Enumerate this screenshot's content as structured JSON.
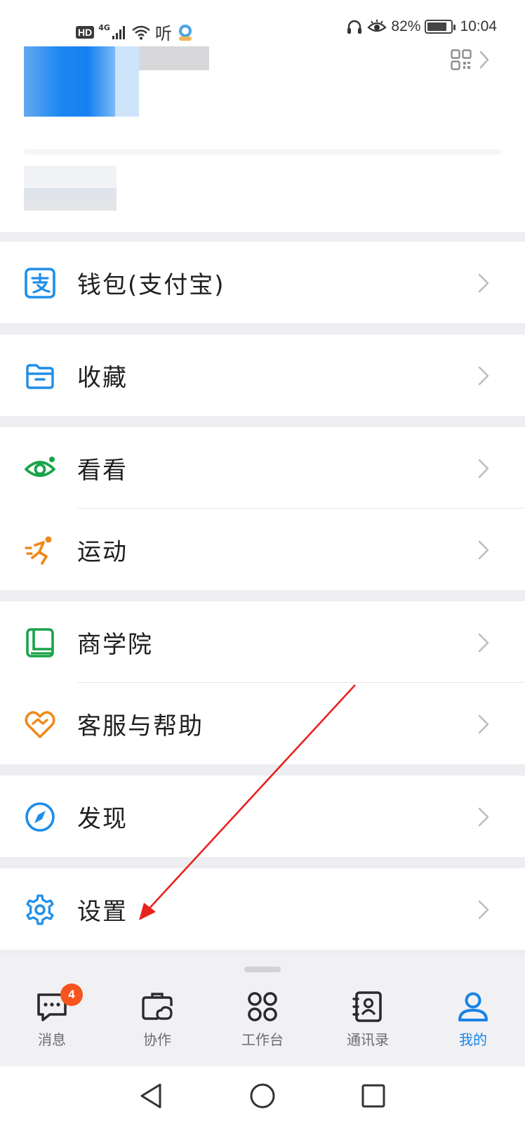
{
  "status_bar": {
    "hd": "HD",
    "network": "4G",
    "listen_glyph": "听",
    "battery": "82%",
    "battery_level": 0.82,
    "time": "10:04"
  },
  "colors": {
    "accent": "#1883e6",
    "badge": "#f6541f",
    "wallet": "#1e8ee8",
    "green": "#1aa34a",
    "orange": "#f0891b"
  },
  "menu": {
    "wallet": "钱包(支付宝)",
    "favorites": "收藏",
    "watch": "看看",
    "sports": "运动",
    "business_school": "商学院",
    "support": "客服与帮助",
    "discover": "发现",
    "settings": "设置"
  },
  "icons": {
    "wallet": "alipay-icon",
    "favorites": "folder-icon",
    "watch": "eye-icon",
    "sports": "running-icon",
    "business_school": "book-icon",
    "support": "heart-handshake-icon",
    "discover": "compass-icon",
    "settings": "gear-icon"
  },
  "tabs": {
    "messages": "消息",
    "messages_badge": "4",
    "collab": "协作",
    "workbench": "工作台",
    "contacts": "通讯录",
    "me": "我的"
  }
}
